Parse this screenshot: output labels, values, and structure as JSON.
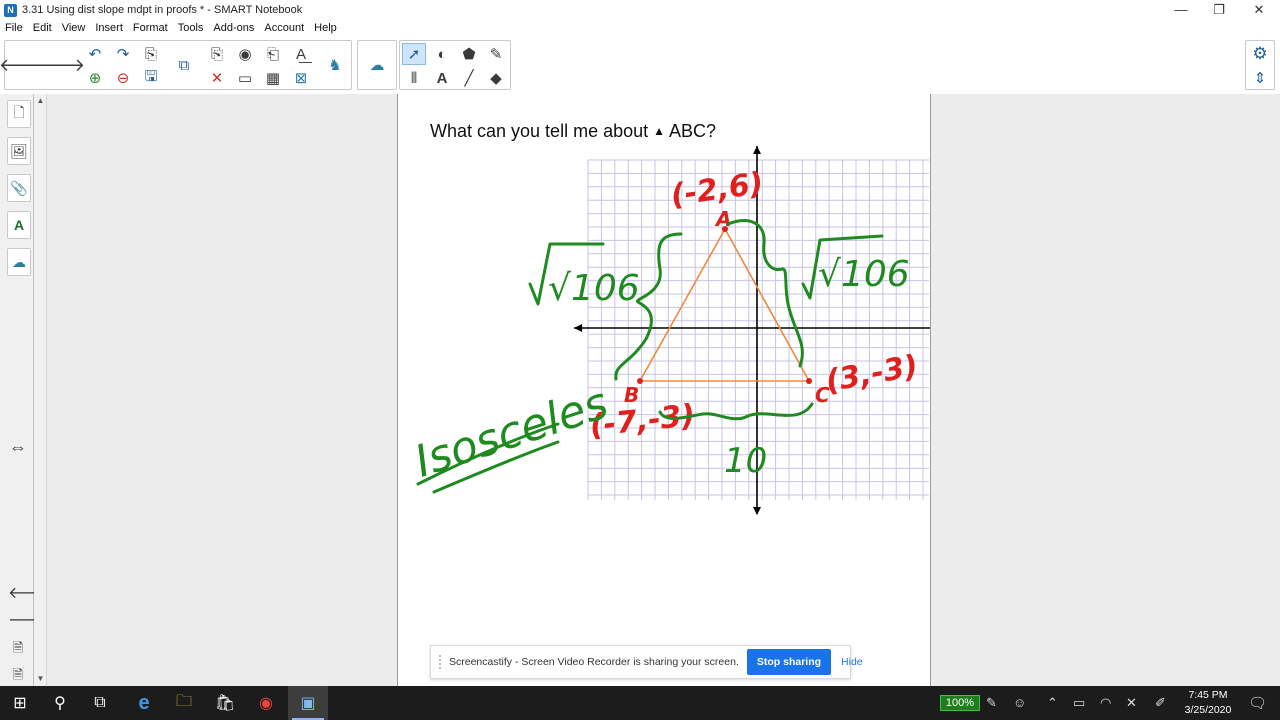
{
  "window": {
    "title": "3.31 Using dist slope mdpt in proofs * - SMART Notebook",
    "icon": "notebook-app-icon",
    "minimize": "—",
    "restore": "❐",
    "close": "✕"
  },
  "menu": [
    "File",
    "Edit",
    "View",
    "Insert",
    "Format",
    "Tools",
    "Add-ons",
    "Account",
    "Help"
  ],
  "toolbar": {
    "back": "🡐",
    "forward": "🡒",
    "undo": "↶",
    "redo": "↷",
    "paste_page": "⎘",
    "screen_shade": "⧉",
    "screen_capture": "◉",
    "properties": "⎗",
    "fonts": "A͟",
    "insert_page": "⊕",
    "delete_page": "⊖",
    "save": "🖫",
    "show_hide": "▢",
    "delete": "✕",
    "full_screen": "▭",
    "table": "▦",
    "clear": "⊠",
    "record": "♞",
    "addons": "☁",
    "select": "➚",
    "shapes": "◐",
    "fill": "⬟",
    "pen": "✎",
    "measure": "⫴",
    "text": "A",
    "line": "╱",
    "eraser": "◆",
    "settings": "⚙",
    "move_toolbar": "⇕"
  },
  "sidetabs": {
    "page_sorter": "🗋",
    "gallery": "🖼",
    "attachments": "📎",
    "properties": "A",
    "addons": "☁",
    "swap_side": "⇔",
    "prev_page": "🡐",
    "next_page": "🡒",
    "add_page": "🗎",
    "delete_page": "🗎"
  },
  "page": {
    "title_prefix": "What can you tell me about ",
    "triangle_symbol": "▲",
    "title_suffix": "ABC?",
    "point_a": "A",
    "point_b": "B",
    "point_c": "C",
    "coord_a": "(-2,6)",
    "coord_b": "(-7,-3)",
    "coord_c": "(3,-3)",
    "side_ab": "√106",
    "side_ac": "√106",
    "side_bc": "10",
    "classification": "Isosceles",
    "colors": {
      "triangle": "#f08a3c",
      "ink_green": "#1f8a1f",
      "ink_red": "#e0201c",
      "grid": "#c7c3e6"
    }
  },
  "screencastify": {
    "message": "Screencastify - Screen Video Recorder is sharing your screen.",
    "stop_label": "Stop sharing",
    "hide_label": "Hide"
  },
  "taskbar": {
    "start": "⊞",
    "search": "⚲",
    "task_view": "⧉",
    "edge": "e",
    "explorer": "🗀",
    "store": "🛍",
    "chrome": "◉",
    "notebook": "▣",
    "battery_percent": "100%",
    "time": "7:45 PM",
    "date": "3/25/2020"
  }
}
